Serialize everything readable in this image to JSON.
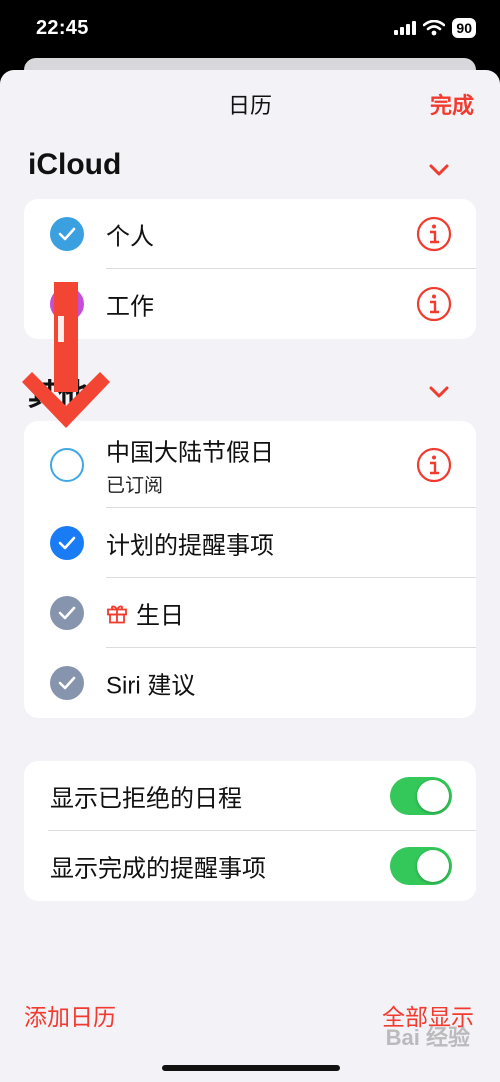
{
  "status": {
    "time": "22:45",
    "battery": "90"
  },
  "header": {
    "title": "日历",
    "done_label": "完成"
  },
  "sections": {
    "icloud": {
      "title": "iCloud",
      "items": [
        {
          "label": "个人",
          "color": "#3aa0e0",
          "checked": true
        },
        {
          "label": "工作",
          "color": "#c44fd6",
          "checked": true
        }
      ]
    },
    "other": {
      "title": "其他",
      "items": [
        {
          "label": "中国大陆节假日",
          "sublabel": "已订阅",
          "color": "#3fa7e6",
          "checked": false
        },
        {
          "label": "计划的提醒事项",
          "color": "#1a7cf5",
          "checked": true
        },
        {
          "label": "生日",
          "color": "#8794ad",
          "checked": true
        },
        {
          "label": "Siri 建议",
          "color": "#8794ad",
          "checked": true
        }
      ]
    }
  },
  "settings": {
    "show_declined": {
      "label": "显示已拒绝的日程",
      "on": true
    },
    "show_completed": {
      "label": "显示完成的提醒事项",
      "on": true
    }
  },
  "footer": {
    "add_calendar": "添加日历",
    "show_all": "全部显示"
  },
  "watermark": "Bai 经验",
  "colors": {
    "accent": "#f23b2f",
    "toggle_on": "#34c759"
  }
}
